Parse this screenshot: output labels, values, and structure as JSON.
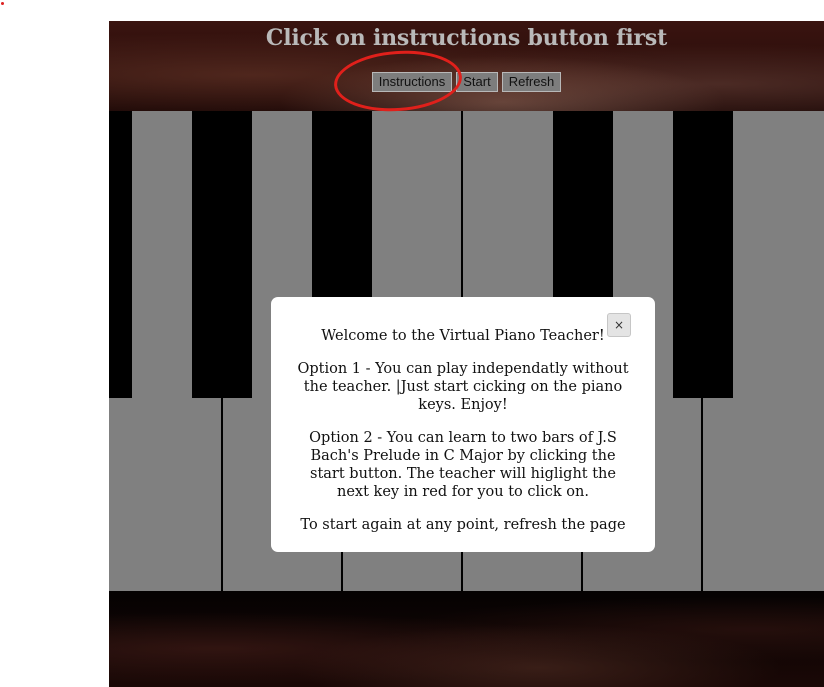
{
  "header": {
    "title": "Click on instructions button first",
    "buttons": {
      "instructions": "Instructions",
      "start": "Start",
      "refresh": "Refresh"
    }
  },
  "modal": {
    "close_icon": "×",
    "welcome": "Welcome to the Virtual Piano Teacher!",
    "option1": "Option 1 - You can play independatly without the teacher. |Just start cicking on the piano keys. Enjoy!",
    "option2": "Option 2 - You can learn to two bars of J.S Bach's Prelude in C Major by clicking the start button. The teacher will higlight the next key in red for you to click on.",
    "restart": "To start again at any point, refresh the page"
  },
  "colors": {
    "annotation": "#e0201b",
    "white_key": "#808080",
    "black_key": "#000000",
    "title": "#b9b9b9"
  }
}
